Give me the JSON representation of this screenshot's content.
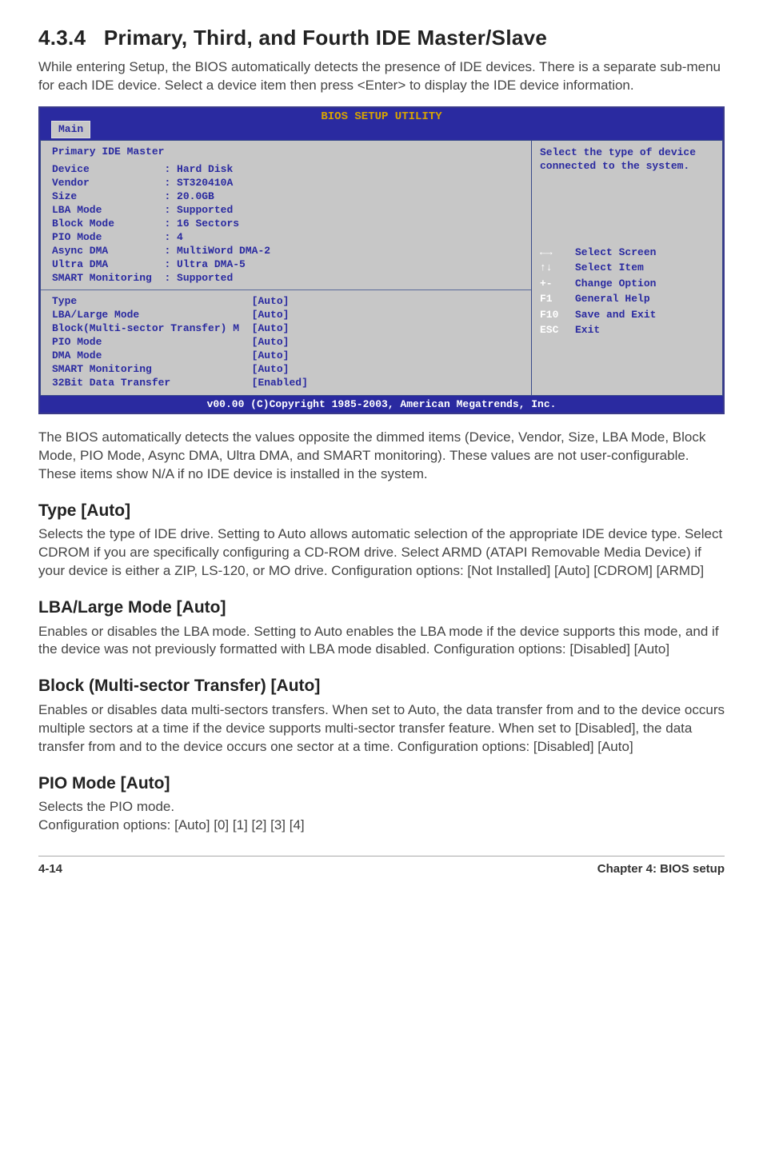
{
  "section": {
    "number": "4.3.4",
    "title": "Primary, Third, and Fourth IDE Master/Slave",
    "intro": "While entering Setup, the BIOS automatically detects the presence of IDE devices. There is a separate sub-menu for each IDE device. Select a device item then press <Enter> to display the IDE device information."
  },
  "bios": {
    "header_title": "BIOS SETUP UTILITY",
    "tab": "Main",
    "panel_title": "Primary IDE Master",
    "info_rows": [
      {
        "label": "Device",
        "value": ": Hard Disk"
      },
      {
        "label": "Vendor",
        "value": ": ST320410A"
      },
      {
        "label": "Size",
        "value": ": 20.0GB"
      },
      {
        "label": "LBA Mode",
        "value": ": Supported"
      },
      {
        "label": "Block Mode",
        "value": ": 16 Sectors"
      },
      {
        "label": "PIO Mode",
        "value": ": 4"
      },
      {
        "label": "Async DMA",
        "value": ": MultiWord DMA-2"
      },
      {
        "label": "Ultra DMA",
        "value": ": Ultra DMA-5"
      },
      {
        "label": "SMART Monitoring",
        "value": ": Supported"
      }
    ],
    "setting_rows": [
      {
        "label": "Type",
        "value": "[Auto]"
      },
      {
        "label": "LBA/Large Mode",
        "value": "[Auto]"
      },
      {
        "label": "Block(Multi-sector Transfer) M",
        "value": "[Auto]"
      },
      {
        "label": "PIO Mode",
        "value": "[Auto]"
      },
      {
        "label": "DMA Mode",
        "value": "[Auto]"
      },
      {
        "label": "SMART Monitoring",
        "value": "[Auto]"
      },
      {
        "label": "32Bit Data Transfer",
        "value": "[Enabled]"
      }
    ],
    "help_top": "Select the type of device connected to the system.",
    "help_keys": [
      {
        "key": "←→",
        "desc": "Select Screen"
      },
      {
        "key": "↑↓",
        "desc": "Select Item"
      },
      {
        "key": "+-",
        "desc": "Change Option"
      },
      {
        "key": "F1",
        "desc": "General Help"
      },
      {
        "key": "F10",
        "desc": "Save and Exit"
      },
      {
        "key": "ESC",
        "desc": "Exit"
      }
    ],
    "footer": "v00.00 (C)Copyright 1985-2003, American Megatrends, Inc."
  },
  "after_bios": "The BIOS automatically detects the values opposite the dimmed items (Device, Vendor, Size, LBA Mode, Block Mode, PIO Mode, Async DMA, Ultra DMA, and SMART monitoring). These values are not user-configurable. These items show N/A if no IDE device is installed in the system.",
  "subs": {
    "type": {
      "title": "Type [Auto]",
      "body": "Selects the type of IDE drive. Setting to Auto allows automatic selection of the appropriate IDE device type. Select CDROM if you are specifically configuring a CD-ROM drive. Select ARMD (ATAPI Removable Media Device) if your device is either a ZIP, LS-120, or MO drive. Configuration options: [Not Installed] [Auto] [CDROM] [ARMD]"
    },
    "lba": {
      "title": "LBA/Large Mode [Auto]",
      "body": "Enables or disables the LBA mode. Setting to Auto enables the LBA mode if the device supports this mode, and if the device was not previously formatted with LBA mode disabled. Configuration options: [Disabled] [Auto]"
    },
    "block": {
      "title": "Block (Multi-sector Transfer) [Auto]",
      "body": "Enables or disables data multi-sectors transfers. When set to Auto, the data transfer from and to the device occurs multiple sectors at a time if the device supports multi-sector transfer feature. When set to [Disabled], the data transfer from and to the device occurs one sector at a time. Configuration options: [Disabled] [Auto]"
    },
    "pio": {
      "title": "PIO Mode [Auto]",
      "body1": "Selects the PIO mode.",
      "body2": "Configuration options: [Auto] [0] [1] [2] [3] [4]"
    }
  },
  "footer": {
    "left": "4-14",
    "right": "Chapter 4: BIOS setup"
  }
}
